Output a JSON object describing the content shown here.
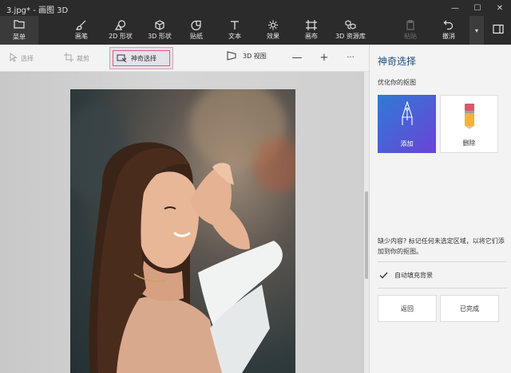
{
  "app": {
    "title": "3.jpg* - 画图 3D"
  },
  "window_controls": {
    "minimize": "—",
    "maximize": "☐",
    "close": "✕"
  },
  "toolbar": {
    "menu_label": "菜单",
    "tools": [
      {
        "label": "画笔",
        "icon": "brush-icon"
      },
      {
        "label": "2D 形状",
        "icon": "2d-shapes-icon"
      },
      {
        "label": "3D 形状",
        "icon": "3d-shapes-icon"
      },
      {
        "label": "贴纸",
        "icon": "sticker-icon"
      },
      {
        "label": "文本",
        "icon": "text-icon"
      },
      {
        "label": "效果",
        "icon": "effects-icon"
      },
      {
        "label": "画布",
        "icon": "canvas-icon"
      },
      {
        "label": "3D 资源库",
        "icon": "3d-library-icon"
      },
      {
        "label": "粘贴",
        "icon": "paste-icon",
        "disabled": true
      },
      {
        "label": "撤消",
        "icon": "undo-icon"
      }
    ],
    "more_glyph": "▾"
  },
  "subtoolbar": {
    "select_label": "选择",
    "crop_label": "裁剪",
    "magic_select_label": "神奇选择",
    "view3d_label": "3D 视图",
    "zoom_out": "—",
    "zoom_in": "+",
    "more": "···"
  },
  "panel": {
    "title": "神奇选择",
    "subtitle": "优化你的抠图",
    "add_label": "添加",
    "remove_label": "删除",
    "hint": "缺少内容? 标记任何未选定区域，以将它们添加到你的抠图。",
    "autofill_label": "自动填充背景",
    "autofill_checked": true,
    "back_label": "返回",
    "done_label": "已完成"
  },
  "colors": {
    "accent": "#1d4e7a",
    "add_gradient_start": "#2f7bd4",
    "add_gradient_end": "#6a43d8",
    "highlight": "#e05a7a"
  }
}
